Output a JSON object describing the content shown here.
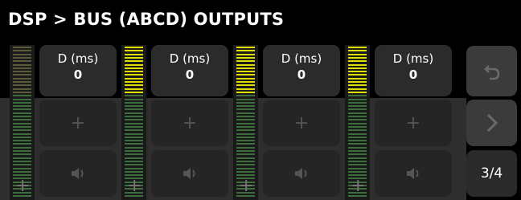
{
  "header": {
    "title": "DSP > BUS (ABCD) OUTPUTS"
  },
  "channels": [
    {
      "delay_label": "D (ms)",
      "delay_value": "0"
    },
    {
      "delay_label": "D (ms)",
      "delay_value": "0"
    },
    {
      "delay_label": "D (ms)",
      "delay_value": "0"
    },
    {
      "delay_label": "D (ms)",
      "delay_value": "0"
    }
  ],
  "icons": {
    "plus": "+",
    "undo": "↶",
    "next": "›",
    "speaker": "🔈"
  },
  "pager": {
    "label": "3/4"
  },
  "colors": {
    "meter_green": "#3d6d3d",
    "meter_yellow": "#e0e000",
    "button": "#2b2b2b",
    "disabled_text": "#555555"
  }
}
